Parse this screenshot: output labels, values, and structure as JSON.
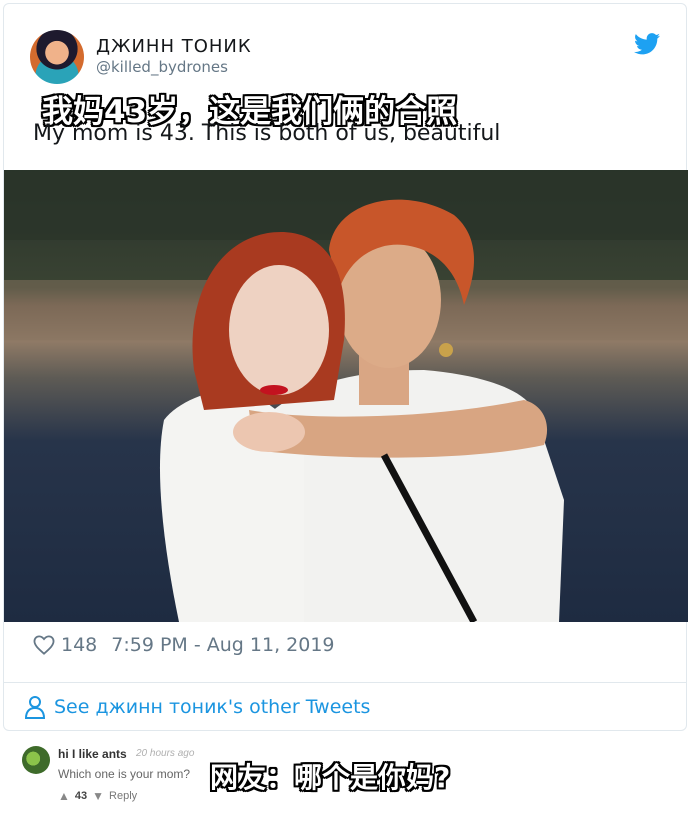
{
  "tweet": {
    "display_name": "ДЖИНН ТОНИК",
    "handle": "@killed_bydrones",
    "text": "My mom is 43. This is both of us, beautiful",
    "likes": "148",
    "timestamp": "7:59 PM - Aug 11, 2019",
    "see_other": "See джинн тоник's other Tweets",
    "brand_color": "#1da1f2"
  },
  "overlays": {
    "top_caption": "我妈43岁，这是我们俩的合照",
    "bottom_caption": "网友：哪个是你妈?"
  },
  "comment": {
    "username": "hi I like ants",
    "time": "20 hours ago",
    "text": "Which one is your mom?",
    "votes": "43",
    "reply_label": "Reply"
  },
  "icons": [
    "twitter-bird-icon",
    "heart-icon",
    "person-icon",
    "upvote-icon",
    "downvote-icon"
  ]
}
